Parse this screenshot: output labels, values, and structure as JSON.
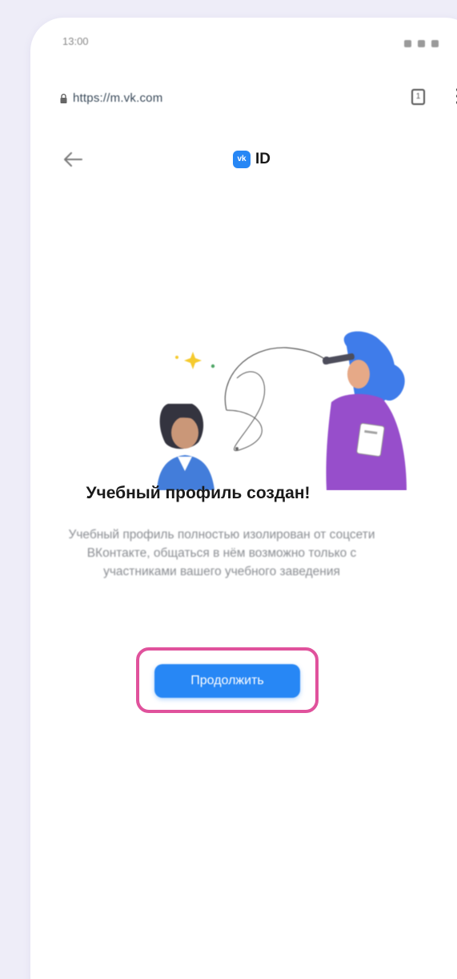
{
  "status_bar": {
    "time": "13:00"
  },
  "browser": {
    "url": "https://m.vk.com",
    "tab_count": "1"
  },
  "header": {
    "logo_badge": "vk",
    "logo_text": "ID"
  },
  "main": {
    "title": "Учебный профиль создан!",
    "description": "Учебный профиль полностью изолирован от соцсети ВКонтакте, общаться в нём возможно только с участниками вашего учебного заведения",
    "continue_label": "Продолжить"
  },
  "colors": {
    "accent": "#2787f5",
    "highlight": "#e0529c",
    "page_background": "#eeedf8"
  },
  "icons": [
    "lock-icon",
    "tabs-icon",
    "menu-icon",
    "back-arrow-icon"
  ]
}
